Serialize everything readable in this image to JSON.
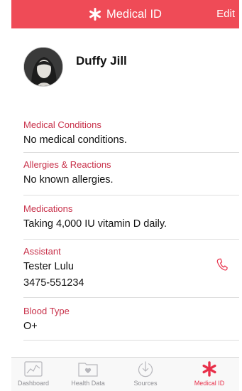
{
  "header": {
    "title": "Medical ID",
    "edit_label": "Edit",
    "title_icon": "asterisk-icon"
  },
  "profile": {
    "name": "Duffy Jill"
  },
  "sections": {
    "conditions": {
      "label": "Medical Conditions",
      "value": "No medical conditions."
    },
    "allergies": {
      "label": "Allergies & Reactions",
      "value": "No known allergies."
    },
    "medications": {
      "label": "Medications",
      "value": "Taking 4,000 IU vitamin D daily."
    },
    "assistant": {
      "label": "Assistant",
      "name": "Tester Lulu",
      "phone": "3475-551234"
    },
    "blood_type": {
      "label": "Blood Type",
      "value": "O+"
    }
  },
  "tabs": [
    {
      "label": "Dashboard",
      "icon": "chart-icon"
    },
    {
      "label": "Health Data",
      "icon": "heart-folder-icon"
    },
    {
      "label": "Sources",
      "icon": "download-circle-icon"
    },
    {
      "label": "Medical ID",
      "icon": "asterisk-icon",
      "active": true
    }
  ],
  "colors": {
    "header_bg": "#ef4b57",
    "section_label": "#c8314a",
    "accent": "#e8304a",
    "tab_inactive": "#8e8e93"
  }
}
